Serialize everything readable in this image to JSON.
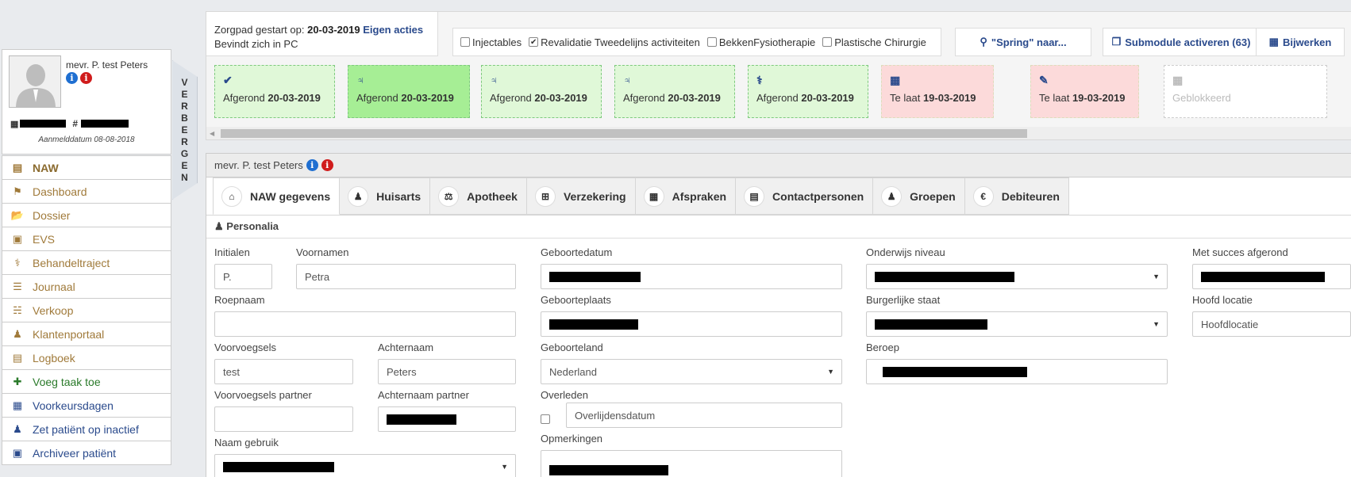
{
  "patient": {
    "name": "mevr. P. test Peters",
    "hash": "#",
    "registration": "Aanmelddatum 08-08-2018"
  },
  "hide_tab": "VERBERGEN",
  "menu": [
    {
      "label": "NAW",
      "icon": "id-card-icon",
      "style": "active"
    },
    {
      "label": "Dashboard",
      "icon": "bookmark-icon",
      "style": ""
    },
    {
      "label": "Dossier",
      "icon": "folder-open-icon",
      "style": ""
    },
    {
      "label": "EVS",
      "icon": "briefcase-medical-icon",
      "style": ""
    },
    {
      "label": "Behandeltraject",
      "icon": "stethoscope-icon",
      "style": ""
    },
    {
      "label": "Journaal",
      "icon": "list-icon",
      "style": ""
    },
    {
      "label": "Verkoop",
      "icon": "basket-icon",
      "style": ""
    },
    {
      "label": "Klantenportaal",
      "icon": "user-doctor-icon",
      "style": ""
    },
    {
      "label": "Logboek",
      "icon": "book-icon",
      "style": ""
    },
    {
      "label": "Voeg taak toe",
      "icon": "plus-icon",
      "style": "green"
    },
    {
      "label": "Voorkeursdagen",
      "icon": "calendar-icon",
      "style": "blue"
    },
    {
      "label": "Zet patiënt op inactief",
      "icon": "user-times-icon",
      "style": "blue"
    },
    {
      "label": "Archiveer patiënt",
      "icon": "archive-icon",
      "style": "blue"
    }
  ],
  "zorgpad": {
    "started_label": "Zorgpad gestart op:",
    "started_date": "20-03-2019",
    "own_actions": "Eigen acties",
    "location": "Bevindt zich in PC"
  },
  "modules": [
    {
      "label": "Injectables",
      "checked": false
    },
    {
      "label": "Revalidatie Tweedelijns activiteiten",
      "checked": true
    },
    {
      "label": "BekkenFysiotherapie",
      "checked": false
    },
    {
      "label": "Plastische Chirurgie",
      "checked": false
    }
  ],
  "buttons": {
    "jump": "\"Spring\" naar...",
    "submodule": "Submodule activeren (63)",
    "update": "Bijwerken"
  },
  "workflow": [
    {
      "status": "Afgerond",
      "date": "20-03-2019",
      "icon": "check-icon",
      "kind": "done"
    },
    {
      "status": "Afgerond",
      "date": "20-03-2019",
      "icon": "signpost-icon",
      "kind": "active"
    },
    {
      "status": "Afgerond",
      "date": "20-03-2019",
      "icon": "signpost-icon",
      "kind": "done"
    },
    {
      "status": "Afgerond",
      "date": "20-03-2019",
      "icon": "signpost-icon",
      "kind": "done"
    },
    {
      "status": "Afgerond",
      "date": "20-03-2019",
      "icon": "stethoscope-icon",
      "kind": "done"
    },
    {
      "status": "Te laat",
      "date": "19-03-2019",
      "icon": "calendar-icon",
      "kind": "late"
    },
    {
      "status": "Te laat",
      "date": "19-03-2019",
      "icon": "pencil-icon",
      "kind": "late"
    },
    {
      "status": "Geblokkeerd",
      "date": "",
      "icon": "calendar-plus-icon",
      "kind": "blocked"
    }
  ],
  "main": {
    "title": "mevr. P. test Peters",
    "section": "Personalia"
  },
  "tabs": [
    {
      "label": "NAW gegevens",
      "icon": "home-icon"
    },
    {
      "label": "Huisarts",
      "icon": "user-doctor-icon"
    },
    {
      "label": "Apotheek",
      "icon": "balance-icon"
    },
    {
      "label": "Verzekering",
      "icon": "plus-square-icon"
    },
    {
      "label": "Afspraken",
      "icon": "calendar-icon"
    },
    {
      "label": "Contactpersonen",
      "icon": "address-book-icon"
    },
    {
      "label": "Groepen",
      "icon": "users-icon"
    },
    {
      "label": "Debiteuren",
      "icon": "euro-icon"
    }
  ],
  "form": {
    "initialen": {
      "label": "Initialen",
      "value": "P."
    },
    "voornamen": {
      "label": "Voornamen",
      "value": "Petra"
    },
    "roepnaam": {
      "label": "Roepnaam",
      "value": ""
    },
    "voorvoegsels": {
      "label": "Voorvoegsels",
      "value": "test"
    },
    "achternaam": {
      "label": "Achternaam",
      "value": "Peters"
    },
    "voorvoegsels_partner": {
      "label": "Voorvoegsels partner",
      "value": ""
    },
    "achternaam_partner": {
      "label": "Achternaam partner"
    },
    "naam_gebruik": {
      "label": "Naam gebruik"
    },
    "geboortedatum": {
      "label": "Geboortedatum"
    },
    "geboorteplaats": {
      "label": "Geboorteplaats"
    },
    "geboorteland": {
      "label": "Geboorteland",
      "value": "Nederland"
    },
    "overleden": {
      "label": "Overleden",
      "placeholder": "Overlijdensdatum"
    },
    "opmerkingen": {
      "label": "Opmerkingen"
    },
    "onderwijs": {
      "label": "Onderwijs niveau"
    },
    "burgerlijke_staat": {
      "label": "Burgerlijke staat"
    },
    "beroep": {
      "label": "Beroep"
    },
    "met_succes": {
      "label": "Met succes afgerond"
    },
    "hoofd_locatie": {
      "label": "Hoofd locatie",
      "value": "Hoofdlocatie"
    }
  }
}
